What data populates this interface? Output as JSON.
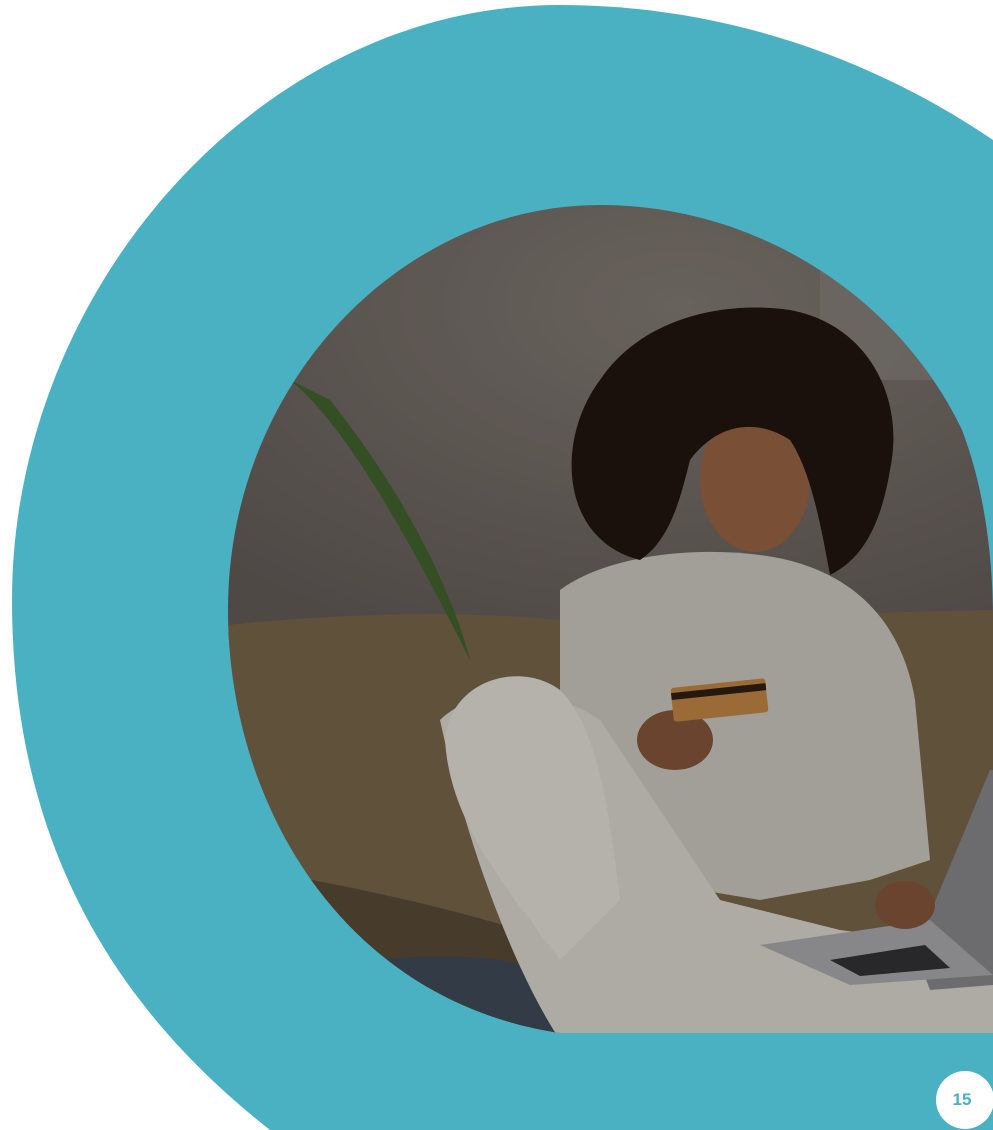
{
  "colors": {
    "accent_teal": "#4ab1c3",
    "background": "#ffffff",
    "photo_wall": "#66605b",
    "photo_sofa": "#6e5d44",
    "photo_hoodie": "#b9b5ae",
    "photo_hair": "#1e140e",
    "photo_card": "#b07a3e",
    "photo_laptop": "#7c7c7e"
  },
  "icons": {
    "photo": "woman-with-credit-card-and-laptop-photo"
  },
  "page": {
    "number": "15"
  }
}
